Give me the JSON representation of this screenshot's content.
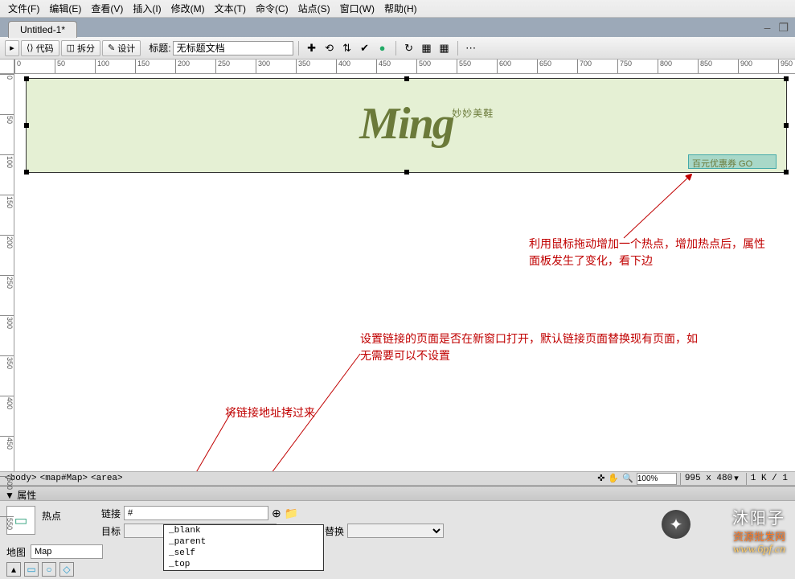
{
  "menubar": {
    "items": [
      {
        "label": "文件(F)"
      },
      {
        "label": "编辑(E)"
      },
      {
        "label": "查看(V)"
      },
      {
        "label": "插入(I)"
      },
      {
        "label": "修改(M)"
      },
      {
        "label": "文本(T)"
      },
      {
        "label": "命令(C)"
      },
      {
        "label": "站点(S)"
      },
      {
        "label": "窗口(W)"
      },
      {
        "label": "帮助(H)"
      }
    ]
  },
  "tab": {
    "label": "Untitled-1*"
  },
  "view_toolbar": {
    "code": "代码",
    "split": "拆分",
    "design": "设计",
    "title_label": "标题:",
    "title_value": "无标题文档"
  },
  "ruler": {
    "h_ticks": [
      0,
      50,
      100,
      150,
      200,
      250,
      300,
      350,
      400,
      450,
      500,
      550,
      600,
      650,
      700,
      750,
      800,
      850,
      900,
      950
    ],
    "v_ticks": [
      0,
      50,
      100,
      150,
      200,
      250,
      300,
      350,
      400,
      450,
      500,
      550
    ]
  },
  "banner": {
    "logo_text": "Ming",
    "logo_sub": "妙妙美鞋",
    "hotspot_label": "百元优惠券 GO"
  },
  "annotations": {
    "anno1": "利用鼠标拖动增加一个热点，增加热点后，属性面板发生了变化，看下边",
    "anno2": "设置链接的页面是否在新窗口打开，默认链接页面替换现有页面，如无需要可以不设置",
    "anno3": "将链接地址拷过来"
  },
  "tag_bar": {
    "tags": [
      "<body>",
      "<map#Map>",
      "<area>"
    ],
    "zoom": "100%",
    "dims": "995 x 480",
    "size": "1 K / 1"
  },
  "props": {
    "header": "属性",
    "hotspot_label": "热点",
    "link_label": "链接",
    "link_value": "#",
    "target_label": "目标",
    "alt_label": "替换",
    "map_label": "地图",
    "map_value": "Map",
    "target_options": [
      "_blank",
      "_parent",
      "_self",
      "_top"
    ]
  },
  "watermark": {
    "title": "沐阳子",
    "sub": "资源批发网",
    "url": "www.6pf.cn"
  }
}
